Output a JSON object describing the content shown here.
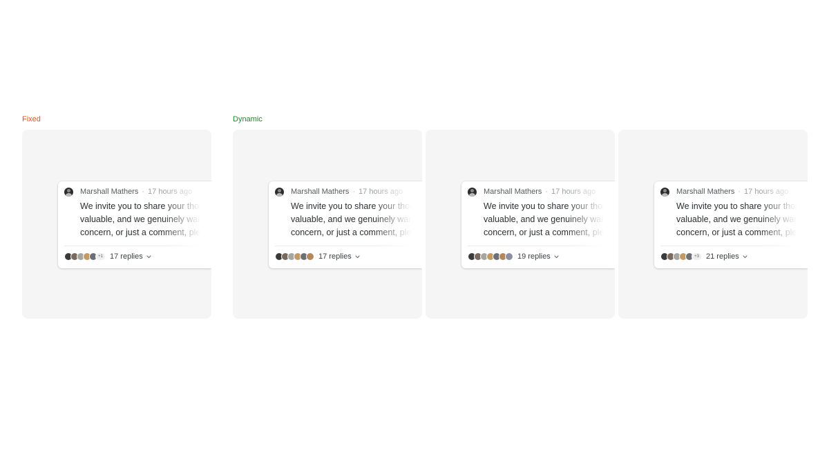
{
  "sections": {
    "fixed_label": "Fixed",
    "dynamic_label": "Dynamic"
  },
  "comment": {
    "author": "Marshall Mathers",
    "separator": "·",
    "timestamp": "17 hours ago",
    "lines": [
      "We invite you to share your thoughts",
      "valuable, and we genuinely want to hear",
      "concern, or just a comment, please"
    ]
  },
  "avatar_colors": [
    "#3a3a3a",
    "#7a6a5e",
    "#a7a59f",
    "#c39a64",
    "#6c6f73",
    "#b6865c",
    "#8d8fa3"
  ],
  "cards": [
    {
      "avatar_count": 5,
      "overflow_label": "+1",
      "replies_label": "17 replies"
    },
    {
      "avatar_count": 6,
      "overflow_label": "",
      "replies_label": "17 replies"
    },
    {
      "avatar_count": 7,
      "overflow_label": "",
      "replies_label": "19 replies"
    },
    {
      "avatar_count": 5,
      "overflow_label": "+3",
      "replies_label": "21 replies"
    }
  ]
}
